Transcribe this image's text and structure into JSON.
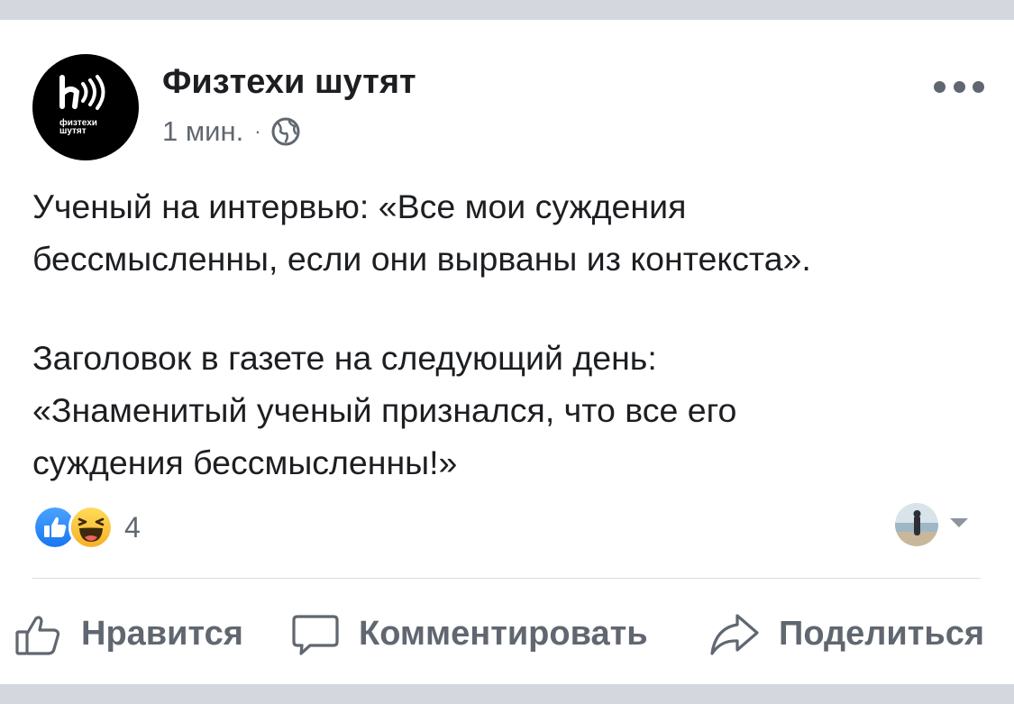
{
  "post": {
    "page_name": "Физтехи шутят",
    "time": "1 мин.",
    "separator": "·",
    "avatar_text_line1": "физтехи",
    "avatar_text_line2": "шутят",
    "text_lines": [
      "Ученый на интервью: «Все мои суждения",
      "бессмысленны, если они вырваны из контекста».",
      "Заголовок в газете на следующий день:",
      "«Знаменитый ученый признался, что все его",
      "суждения бессмысленны!»"
    ]
  },
  "reactions": {
    "count": "4",
    "types": [
      "like-icon",
      "haha-icon"
    ]
  },
  "actions": {
    "like_label": "Нравится",
    "comment_label": "Комментировать",
    "share_label": "Поделиться"
  },
  "colors": {
    "text": "#1c1e21",
    "secondary": "#606770",
    "like_blue": "#1877f2",
    "haha_yellow": "#f7b125",
    "divider": "#dadde1",
    "bars": "#d4d7de"
  }
}
